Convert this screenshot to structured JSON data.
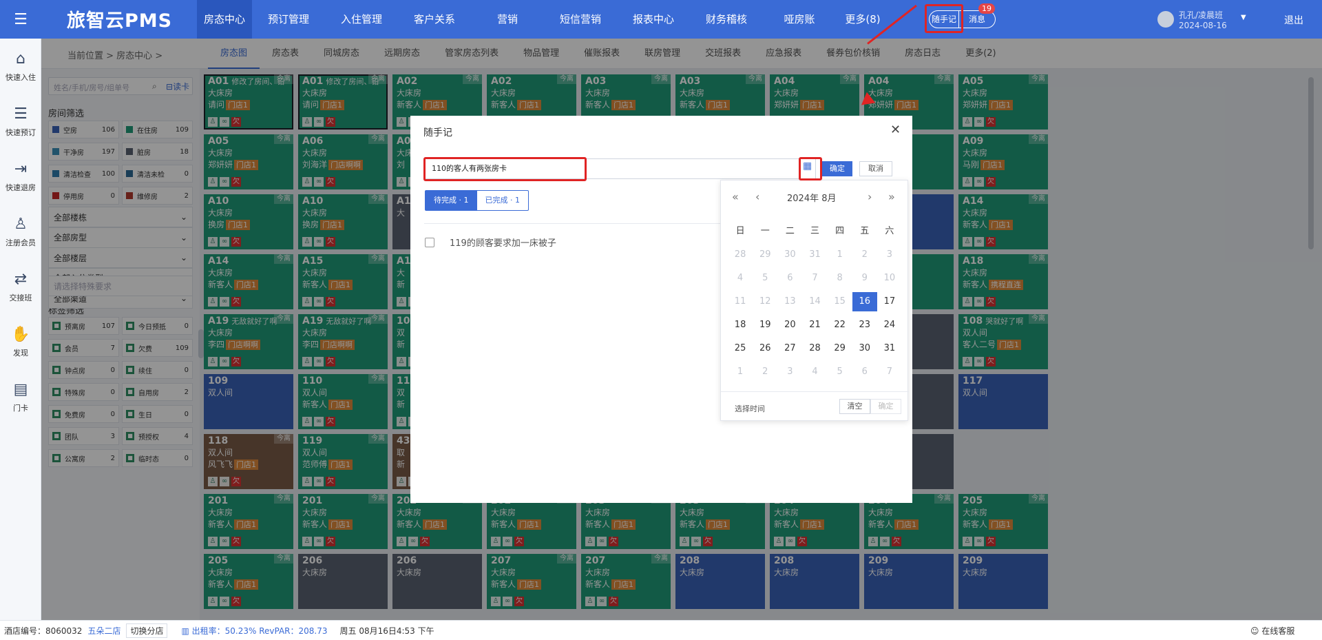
{
  "app": {
    "logo": "旅智云PMS"
  },
  "nav": [
    {
      "label": "房态中心",
      "active": true
    },
    {
      "label": "预订管理"
    },
    {
      "label": "入住管理"
    },
    {
      "label": "客户关系"
    },
    {
      "label": "营销"
    },
    {
      "label": "短信营销"
    },
    {
      "label": "报表中心"
    },
    {
      "label": "财务稽核"
    },
    {
      "label": "哑房账"
    },
    {
      "label": "更多(8)"
    }
  ],
  "header": {
    "memo": "随手记",
    "message": "消息",
    "message_count": "19",
    "user": "孔孔/凌晨班",
    "date": "2024-08-16",
    "logout": "退出"
  },
  "leftbar": [
    {
      "icon": "home-icon",
      "glyph": "⌂",
      "label": "快速入住"
    },
    {
      "icon": "calendar-list-icon",
      "glyph": "☰",
      "label": "快速预订"
    },
    {
      "icon": "checkout-icon",
      "glyph": "⇥",
      "label": "快速退房"
    },
    {
      "icon": "user-add-icon",
      "glyph": "♙",
      "label": "注册会员"
    },
    {
      "icon": "shift-icon",
      "glyph": "⇄",
      "label": "交接班"
    },
    {
      "icon": "discover-icon",
      "glyph": "✋",
      "label": "发现"
    },
    {
      "icon": "card-icon",
      "glyph": "▤",
      "label": "门卡"
    }
  ],
  "breadcrumb": "当前位置 > 房态中心 >",
  "subtabs": [
    "房态图",
    "房态表",
    "同城房态",
    "远期房态",
    "管家房态列表",
    "物品管理",
    "催账报表",
    "联房管理",
    "交班报表",
    "应急报表",
    "餐券包价核销",
    "房态日志",
    "更多(2)"
  ],
  "filter": {
    "search_placeholder": "姓名/手机/房号/组单号",
    "readcard": "读卡",
    "room_title": "房间筛选",
    "room_stats": [
      {
        "label": "空房",
        "count": "106",
        "color": "#3a62b8"
      },
      {
        "label": "在住房",
        "count": "109",
        "color": "#1f9b79"
      },
      {
        "label": "干净房",
        "count": "197",
        "color": "#3a8fb8"
      },
      {
        "label": "脏房",
        "count": "18",
        "color": "#5a6373"
      },
      {
        "label": "清洁检查",
        "count": "100",
        "color": "#2f7fb0"
      },
      {
        "label": "清洁未检",
        "count": "0",
        "color": "#2b6a94"
      },
      {
        "label": "停用房",
        "count": "0",
        "color": "#c62828"
      },
      {
        "label": "维修房",
        "count": "2",
        "color": "#b23a2e"
      }
    ],
    "selects": [
      "全部楼栋",
      "全部房型",
      "全部楼层",
      "全部入住类型",
      "全部渠道"
    ],
    "special_placeholder": "请选择特殊要求",
    "tag_title": "标签筛选",
    "tags": [
      {
        "label": "预离房",
        "count": "107"
      },
      {
        "label": "今日预抵",
        "count": "0"
      },
      {
        "label": "会员",
        "count": "7"
      },
      {
        "label": "欠费",
        "count": "109"
      },
      {
        "label": "钟点房",
        "count": "0"
      },
      {
        "label": "续住",
        "count": "0"
      },
      {
        "label": "特殊房",
        "count": "0"
      },
      {
        "label": "自用房",
        "count": "2"
      },
      {
        "label": "免费房",
        "count": "0"
      },
      {
        "label": "生日",
        "count": "0"
      },
      {
        "label": "团队",
        "count": "3"
      },
      {
        "label": "预授权",
        "count": "4"
      },
      {
        "label": "公寓房",
        "count": "2"
      },
      {
        "label": "临时态",
        "count": "0"
      }
    ]
  },
  "rooms": [
    {
      "name": "A01",
      "note": "修改了房间、铅",
      "type": "大床房",
      "guest": "请问",
      "ch": "门店1",
      "status": "occ",
      "badge": "今离",
      "sel": true
    },
    {
      "name": "A01",
      "note": "修改了房间、铅",
      "type": "大床房",
      "guest": "请问",
      "ch": "门店1",
      "status": "occ",
      "badge": "今离",
      "sel": true
    },
    {
      "name": "A02",
      "note": "",
      "type": "大床房",
      "guest": "新客人",
      "ch": "门店1",
      "status": "occ",
      "badge": "今离"
    },
    {
      "name": "A02",
      "note": "",
      "type": "大床房",
      "guest": "新客人",
      "ch": "门店1",
      "status": "occ",
      "badge": "今离"
    },
    {
      "name": "A03",
      "note": "",
      "type": "大床房",
      "guest": "新客人",
      "ch": "门店1",
      "status": "occ",
      "badge": "今离"
    },
    {
      "name": "A03",
      "note": "",
      "type": "大床房",
      "guest": "新客人",
      "ch": "门店1",
      "status": "occ",
      "badge": "今离"
    },
    {
      "name": "A04",
      "note": "",
      "type": "大床房",
      "guest": "郑妍妍",
      "ch": "门店1",
      "status": "occ",
      "badge": "今离"
    },
    {
      "name": "A04",
      "note": "",
      "type": "大床房",
      "guest": "郑妍妍",
      "ch": "门店1",
      "status": "occ",
      "badge": "今离"
    },
    {
      "name": "A05",
      "note": "",
      "type": "大床房",
      "guest": "郑妍妍",
      "ch": "门店1",
      "status": "occ",
      "badge": "今离"
    },
    {
      "name": "A05",
      "note": "",
      "type": "大床房",
      "guest": "郑妍妍",
      "ch": "门店1",
      "status": "occ",
      "badge": "今离"
    },
    {
      "name": "A06",
      "note": "",
      "type": "大床房",
      "guest": "刘海洋",
      "ch": "门店啊啊",
      "status": "occ",
      "badge": "今离"
    },
    {
      "name": "A07",
      "note": "",
      "type": "大床房",
      "guest": "刘",
      "ch": "",
      "status": "occ",
      "badge": ""
    },
    {
      "name": "",
      "note": "",
      "type": "",
      "guest": "",
      "ch": "",
      "status": "occ",
      "badge": ""
    },
    {
      "name": "",
      "note": "",
      "type": "",
      "guest": "",
      "ch": "",
      "status": "occ",
      "badge": ""
    },
    {
      "name": "",
      "note": "",
      "type": "",
      "guest": "",
      "ch": "",
      "status": "occ",
      "badge": ""
    },
    {
      "name": "",
      "note": "",
      "type": "",
      "guest": "",
      "ch": "",
      "status": "occ",
      "badge": ""
    },
    {
      "name": "",
      "note": "",
      "type": "",
      "guest": "",
      "ch": "",
      "status": "occ",
      "badge": ""
    },
    {
      "name": "A09",
      "note": "",
      "type": "大床房",
      "guest": "马刚",
      "ch": "门店1",
      "status": "occ",
      "badge": "今离"
    },
    {
      "name": "A10",
      "note": "",
      "type": "大床房",
      "guest": "换房",
      "ch": "门店1",
      "status": "occ",
      "badge": "今离"
    },
    {
      "name": "A10",
      "note": "",
      "type": "大床房",
      "guest": "换房",
      "ch": "门店1",
      "status": "occ",
      "badge": "今离"
    },
    {
      "name": "A1",
      "note": "",
      "type": "大",
      "guest": "",
      "ch": "",
      "status": "dirty",
      "badge": ""
    },
    {
      "name": "",
      "note": "",
      "type": "",
      "guest": "",
      "ch": "",
      "status": "occ",
      "badge": ""
    },
    {
      "name": "",
      "note": "",
      "type": "",
      "guest": "",
      "ch": "",
      "status": "occ",
      "badge": ""
    },
    {
      "name": "",
      "note": "",
      "type": "",
      "guest": "",
      "ch": "",
      "status": "occ",
      "badge": ""
    },
    {
      "name": "",
      "note": "",
      "type": "",
      "guest": "",
      "ch": "",
      "status": "occ",
      "badge": ""
    },
    {
      "name": "",
      "note": "",
      "type": "",
      "guest": "",
      "ch": "",
      "status": "vac",
      "badge": ""
    },
    {
      "name": "A14",
      "note": "",
      "type": "大床房",
      "guest": "新客人",
      "ch": "门店1",
      "status": "occ",
      "badge": "今离"
    },
    {
      "name": "A14",
      "note": "",
      "type": "大床房",
      "guest": "新客人",
      "ch": "门店1",
      "status": "occ",
      "badge": "今离"
    },
    {
      "name": "A15",
      "note": "",
      "type": "大床房",
      "guest": "新客人",
      "ch": "门店1",
      "status": "occ",
      "badge": "今离"
    },
    {
      "name": "A1",
      "note": "",
      "type": "大",
      "guest": "新",
      "ch": "",
      "status": "occ",
      "badge": ""
    },
    {
      "name": "",
      "note": "",
      "type": "",
      "guest": "",
      "ch": "",
      "status": "occ",
      "badge": ""
    },
    {
      "name": "",
      "note": "",
      "type": "",
      "guest": "",
      "ch": "",
      "status": "occ",
      "badge": ""
    },
    {
      "name": "",
      "note": "",
      "type": "",
      "guest": "",
      "ch": "",
      "status": "occ",
      "badge": ""
    },
    {
      "name": "",
      "note": "",
      "type": "",
      "guest": "",
      "ch": "",
      "status": "occ",
      "badge": ""
    },
    {
      "name": "",
      "note": "",
      "type": "",
      "guest": "",
      "ch": "直连",
      "status": "occ",
      "badge": ""
    },
    {
      "name": "A18",
      "note": "",
      "type": "大床房",
      "guest": "新客人",
      "ch": "携程直连",
      "status": "occ",
      "badge": "今离"
    },
    {
      "name": "A19",
      "note": "无敌就好了啊",
      "type": "大床房",
      "guest": "李四",
      "ch": "门店啊啊",
      "status": "occ",
      "badge": "今离"
    },
    {
      "name": "A19",
      "note": "无敌就好了啊",
      "type": "大床房",
      "guest": "李四",
      "ch": "门店啊啊",
      "status": "occ",
      "badge": "今离"
    },
    {
      "name": "10",
      "note": "",
      "type": "双",
      "guest": "新",
      "ch": "",
      "status": "occ",
      "badge": ""
    },
    {
      "name": "",
      "note": "",
      "type": "",
      "guest": "",
      "ch": "",
      "status": "occ",
      "badge": ""
    },
    {
      "name": "",
      "note": "",
      "type": "",
      "guest": "",
      "ch": "",
      "status": "occ",
      "badge": ""
    },
    {
      "name": "",
      "note": "",
      "type": "",
      "guest": "",
      "ch": "",
      "status": "occ",
      "badge": ""
    },
    {
      "name": "",
      "note": "",
      "type": "",
      "guest": "",
      "ch": "",
      "status": "occ",
      "badge": ""
    },
    {
      "name": "",
      "note": "",
      "type": "",
      "guest": "",
      "ch": "",
      "status": "dirty",
      "badge": ""
    },
    {
      "name": "108",
      "note": "哭就好了啊",
      "type": "双人间",
      "guest": "客人二号",
      "ch": "门店1",
      "status": "occ",
      "badge": "今离"
    },
    {
      "name": "109",
      "note": "",
      "type": "双人间",
      "guest": "",
      "ch": "",
      "status": "vac",
      "badge": ""
    },
    {
      "name": "110",
      "note": "",
      "type": "双人间",
      "guest": "新客人",
      "ch": "门店1",
      "status": "occ",
      "badge": "今离"
    },
    {
      "name": "11",
      "note": "",
      "type": "双",
      "guest": "新",
      "ch": "",
      "status": "occ",
      "badge": ""
    },
    {
      "name": "",
      "note": "",
      "type": "",
      "guest": "",
      "ch": "",
      "status": "occ",
      "badge": ""
    },
    {
      "name": "",
      "note": "",
      "type": "",
      "guest": "",
      "ch": "",
      "status": "occ",
      "badge": ""
    },
    {
      "name": "",
      "note": "",
      "type": "",
      "guest": "",
      "ch": "",
      "status": "occ",
      "badge": ""
    },
    {
      "name": "",
      "note": "",
      "type": "",
      "guest": "",
      "ch": "",
      "status": "occ",
      "badge": ""
    },
    {
      "name": "",
      "note": "",
      "type": "",
      "guest": "",
      "ch": "",
      "status": "dirty",
      "badge": ""
    },
    {
      "name": "117",
      "note": "",
      "type": "双人间",
      "guest": "",
      "ch": "",
      "status": "vac",
      "badge": ""
    },
    {
      "name": "118",
      "note": "",
      "type": "双人间",
      "guest": "风飞飞",
      "ch": "门店1",
      "status": "brown",
      "badge": "今离"
    },
    {
      "name": "119",
      "note": "",
      "type": "双人间",
      "guest": "范师傅",
      "ch": "门店1",
      "status": "occ",
      "badge": "今离"
    },
    {
      "name": "43",
      "note": "",
      "type": "取",
      "guest": "新",
      "ch": "",
      "status": "brown",
      "badge": ""
    },
    {
      "name": "",
      "note": "",
      "type": "",
      "guest": "",
      "ch": "",
      "status": "occ",
      "badge": ""
    },
    {
      "name": "",
      "note": "",
      "type": "",
      "guest": "",
      "ch": "",
      "status": "occ",
      "badge": ""
    },
    {
      "name": "",
      "note": "",
      "type": "",
      "guest": "",
      "ch": "",
      "status": "occ",
      "badge": ""
    },
    {
      "name": "",
      "note": "",
      "type": "",
      "guest": "",
      "ch": "",
      "status": "occ",
      "badge": ""
    },
    {
      "name": "",
      "note": "",
      "type": "",
      "guest": "",
      "ch": "",
      "status": "dirty",
      "badge": ""
    },
    {
      "name": "",
      "note": "",
      "type": "",
      "guest": "",
      "ch": "",
      "status": "none",
      "badge": ""
    },
    {
      "name": "201",
      "note": "",
      "type": "大床房",
      "guest": "新客人",
      "ch": "门店1",
      "status": "occ",
      "badge": "今离"
    },
    {
      "name": "201",
      "note": "",
      "type": "大床房",
      "guest": "新客人",
      "ch": "门店1",
      "status": "occ",
      "badge": "今离"
    },
    {
      "name": "202",
      "note": "",
      "type": "大床房",
      "guest": "新客人",
      "ch": "门店1",
      "status": "occ",
      "badge": "今离"
    },
    {
      "name": "202",
      "note": "",
      "type": "大床房",
      "guest": "新客人",
      "ch": "门店1",
      "status": "occ",
      "badge": "今离"
    },
    {
      "name": "203",
      "note": "",
      "type": "大床房",
      "guest": "新客人",
      "ch": "门店1",
      "status": "occ",
      "badge": "今离"
    },
    {
      "name": "203",
      "note": "",
      "type": "大床房",
      "guest": "新客人",
      "ch": "门店1",
      "status": "occ",
      "badge": "今离"
    },
    {
      "name": "204",
      "note": "",
      "type": "大床房",
      "guest": "新客人",
      "ch": "门店1",
      "status": "occ",
      "badge": "今离"
    },
    {
      "name": "204",
      "note": "",
      "type": "大床房",
      "guest": "新客人",
      "ch": "门店1",
      "status": "occ",
      "badge": "今离"
    },
    {
      "name": "205",
      "note": "",
      "type": "大床房",
      "guest": "新客人",
      "ch": "门店1",
      "status": "occ",
      "badge": "今离"
    },
    {
      "name": "205",
      "note": "",
      "type": "大床房",
      "guest": "新客人",
      "ch": "门店1",
      "status": "occ",
      "badge": "今离"
    },
    {
      "name": "206",
      "note": "",
      "type": "大床房",
      "guest": "",
      "ch": "",
      "status": "dirty",
      "badge": ""
    },
    {
      "name": "206",
      "note": "",
      "type": "大床房",
      "guest": "",
      "ch": "",
      "status": "dirty",
      "badge": ""
    },
    {
      "name": "207",
      "note": "",
      "type": "大床房",
      "guest": "新客人",
      "ch": "门店1",
      "status": "occ",
      "badge": "今离"
    },
    {
      "name": "207",
      "note": "",
      "type": "大床房",
      "guest": "新客人",
      "ch": "门店1",
      "status": "occ",
      "badge": "今离"
    },
    {
      "name": "208",
      "note": "",
      "type": "大床房",
      "guest": "",
      "ch": "",
      "status": "vac",
      "badge": ""
    },
    {
      "name": "208",
      "note": "",
      "type": "大床房",
      "guest": "",
      "ch": "",
      "status": "vac",
      "badge": ""
    },
    {
      "name": "209",
      "note": "",
      "type": "大床房",
      "guest": "",
      "ch": "",
      "status": "vac",
      "badge": ""
    },
    {
      "name": "209",
      "note": "",
      "type": "大床房",
      "guest": "",
      "ch": "",
      "status": "vac",
      "badge": ""
    }
  ],
  "modal": {
    "title": "随手记",
    "input_value": "110的客人有两张房卡",
    "ok": "确定",
    "cancel": "取消",
    "tab_pending": "待完成 · 1",
    "tab_done": "已完成 · 1",
    "task": "119的顾客要求加一床被子"
  },
  "datepicker": {
    "title": "2024年  8月",
    "weekdays": [
      "日",
      "一",
      "二",
      "三",
      "四",
      "五",
      "六"
    ],
    "days": [
      [
        "28",
        "m"
      ],
      [
        "29",
        "m"
      ],
      [
        "30",
        "m"
      ],
      [
        "31",
        "m"
      ],
      [
        "1",
        "m"
      ],
      [
        "2",
        "m"
      ],
      [
        "3",
        "m"
      ],
      [
        "4",
        "m"
      ],
      [
        "5",
        "m"
      ],
      [
        "6",
        "m"
      ],
      [
        "7",
        "m"
      ],
      [
        "8",
        "m"
      ],
      [
        "9",
        "m"
      ],
      [
        "10",
        "m"
      ],
      [
        "11",
        "m"
      ],
      [
        "12",
        "m"
      ],
      [
        "13",
        "m"
      ],
      [
        "14",
        "m"
      ],
      [
        "15",
        "m"
      ],
      [
        "16",
        "t"
      ],
      [
        "17",
        ""
      ],
      [
        "18",
        ""
      ],
      [
        "19",
        ""
      ],
      [
        "20",
        ""
      ],
      [
        "21",
        ""
      ],
      [
        "22",
        ""
      ],
      [
        "23",
        ""
      ],
      [
        "24",
        ""
      ],
      [
        "25",
        ""
      ],
      [
        "26",
        ""
      ],
      [
        "27",
        ""
      ],
      [
        "28",
        ""
      ],
      [
        "29",
        ""
      ],
      [
        "30",
        ""
      ],
      [
        "31",
        ""
      ],
      [
        "1",
        "m"
      ],
      [
        "2",
        "m"
      ],
      [
        "3",
        "m"
      ],
      [
        "4",
        "m"
      ],
      [
        "5",
        "m"
      ],
      [
        "6",
        "m"
      ],
      [
        "7",
        "m"
      ]
    ],
    "select_time": "选择时间",
    "clear": "清空",
    "confirm": "确定"
  },
  "statusbar": {
    "hotel_label": "酒店编号：8060032",
    "store": "五朵二店",
    "switch": "切换分店",
    "stats": "出租率：50.23%  RevPAR：208.73",
    "time": "周五 08月16日4:53 下午",
    "service": "在线客服"
  }
}
